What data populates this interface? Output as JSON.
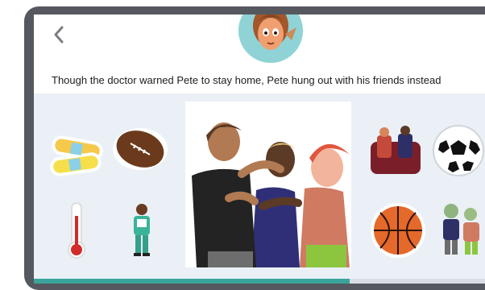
{
  "sentence": "Though the doctor warned Pete to stay home, Pete hung out with his friends instead",
  "icons": {
    "back": "chevron-left-icon",
    "left_cards": [
      "bandages-icon",
      "football-icon",
      "thermometer-icon",
      "doctor-icon"
    ],
    "right_cards": [
      "friends-on-couch-icon",
      "soccer-ball-icon",
      "basketball-icon",
      "zombies-icon"
    ]
  },
  "colors": {
    "device_frame": "#55585e",
    "stage_bg": "#eaf0f6",
    "progress": "#3aa59c"
  },
  "progress": {
    "value": 0.7
  }
}
